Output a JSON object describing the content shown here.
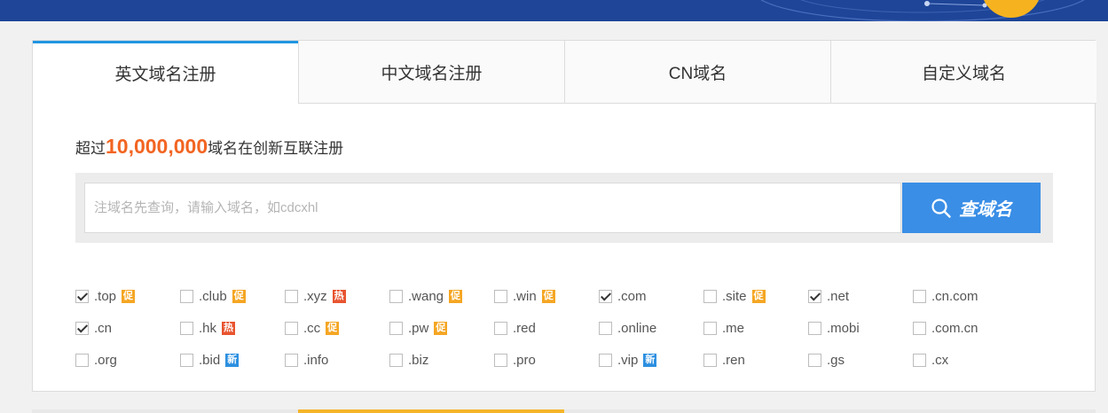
{
  "colors": {
    "banner": "#1e4597",
    "tab_accent": "#1f95e1",
    "count_accent": "#f26522",
    "search_button": "#3a8ee6",
    "badge_promo": "#f5a623",
    "badge_hot": "#e8542f",
    "badge_new": "#2c8fe0"
  },
  "tabs": [
    {
      "label": "英文域名注册",
      "active": true
    },
    {
      "label": "中文域名注册",
      "active": false
    },
    {
      "label": "CN域名",
      "active": false
    },
    {
      "label": "自定义域名",
      "active": false
    }
  ],
  "headline": {
    "prefix": "超过",
    "count": "10,000,000",
    "suffix": "域名在创新互联注册"
  },
  "search": {
    "placeholder": "注域名先查询，请输入域名，如cdcxhl",
    "value": "",
    "button_label": "查域名",
    "button_icon": "search-icon"
  },
  "tlds": [
    {
      "name": ".top",
      "checked": true,
      "badge": "促",
      "badge_type": "promo"
    },
    {
      "name": ".club",
      "checked": false,
      "badge": "促",
      "badge_type": "promo"
    },
    {
      "name": ".xyz",
      "checked": false,
      "badge": "热",
      "badge_type": "hot"
    },
    {
      "name": ".wang",
      "checked": false,
      "badge": "促",
      "badge_type": "promo"
    },
    {
      "name": ".win",
      "checked": false,
      "badge": "促",
      "badge_type": "promo"
    },
    {
      "name": ".com",
      "checked": true,
      "badge": "",
      "badge_type": ""
    },
    {
      "name": ".site",
      "checked": false,
      "badge": "促",
      "badge_type": "promo"
    },
    {
      "name": ".net",
      "checked": true,
      "badge": "",
      "badge_type": ""
    },
    {
      "name": ".cn.com",
      "checked": false,
      "badge": "",
      "badge_type": ""
    },
    {
      "name": ".cn",
      "checked": true,
      "badge": "",
      "badge_type": ""
    },
    {
      "name": ".hk",
      "checked": false,
      "badge": "热",
      "badge_type": "hot"
    },
    {
      "name": ".cc",
      "checked": false,
      "badge": "促",
      "badge_type": "promo"
    },
    {
      "name": ".pw",
      "checked": false,
      "badge": "促",
      "badge_type": "promo"
    },
    {
      "name": ".red",
      "checked": false,
      "badge": "",
      "badge_type": ""
    },
    {
      "name": ".online",
      "checked": false,
      "badge": "",
      "badge_type": ""
    },
    {
      "name": ".me",
      "checked": false,
      "badge": "",
      "badge_type": ""
    },
    {
      "name": ".mobi",
      "checked": false,
      "badge": "",
      "badge_type": ""
    },
    {
      "name": ".com.cn",
      "checked": false,
      "badge": "",
      "badge_type": ""
    },
    {
      "name": ".org",
      "checked": false,
      "badge": "",
      "badge_type": ""
    },
    {
      "name": ".bid",
      "checked": false,
      "badge": "新",
      "badge_type": "new"
    },
    {
      "name": ".info",
      "checked": false,
      "badge": "",
      "badge_type": ""
    },
    {
      "name": ".biz",
      "checked": false,
      "badge": "",
      "badge_type": ""
    },
    {
      "name": ".pro",
      "checked": false,
      "badge": "",
      "badge_type": ""
    },
    {
      "name": ".vip",
      "checked": false,
      "badge": "新",
      "badge_type": "new"
    },
    {
      "name": ".ren",
      "checked": false,
      "badge": "",
      "badge_type": ""
    },
    {
      "name": ".gs",
      "checked": false,
      "badge": "",
      "badge_type": ""
    },
    {
      "name": ".cx",
      "checked": false,
      "badge": "",
      "badge_type": ""
    }
  ]
}
